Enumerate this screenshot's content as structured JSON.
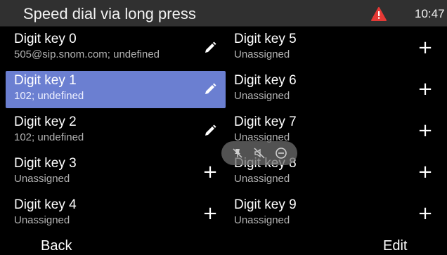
{
  "statusbar": {
    "title": "Speed dial via long press",
    "warning_icon": "warning-triangle-icon",
    "warning_color": "#e53935",
    "time": "10:47"
  },
  "keys": [
    {
      "name": "Digit key 0",
      "sub": "505@sip.snom.com; undefined",
      "action": "edit-pencil-icon"
    },
    {
      "name": "Digit key 1",
      "sub": "102; undefined",
      "action": "edit-pencil-icon",
      "selected": true
    },
    {
      "name": "Digit key 2",
      "sub": "102; undefined",
      "action": "edit-pencil-icon"
    },
    {
      "name": "Digit key 3",
      "sub": "Unassigned",
      "action": "plus-icon"
    },
    {
      "name": "Digit key 4",
      "sub": "Unassigned",
      "action": "plus-icon"
    },
    {
      "name": "Digit key 5",
      "sub": "Unassigned",
      "action": "plus-icon"
    },
    {
      "name": "Digit key 6",
      "sub": "Unassigned",
      "action": "plus-icon"
    },
    {
      "name": "Digit key 7",
      "sub": "Unassigned",
      "action": "plus-icon"
    },
    {
      "name": "Digit key 8",
      "sub": "Unassigned",
      "action": "plus-icon"
    },
    {
      "name": "Digit key 9",
      "sub": "Unassigned",
      "action": "plus-icon"
    }
  ],
  "plus_symbol": "+",
  "overlay_icons": [
    "pin-off-icon",
    "speaker-muted-icon",
    "do-not-disturb-icon"
  ],
  "softkeys": {
    "left": "Back",
    "right": "Edit"
  },
  "colors": {
    "selected_bg": "#6b7fd1",
    "statusbar_bg": "#303030",
    "background": "#000000"
  }
}
